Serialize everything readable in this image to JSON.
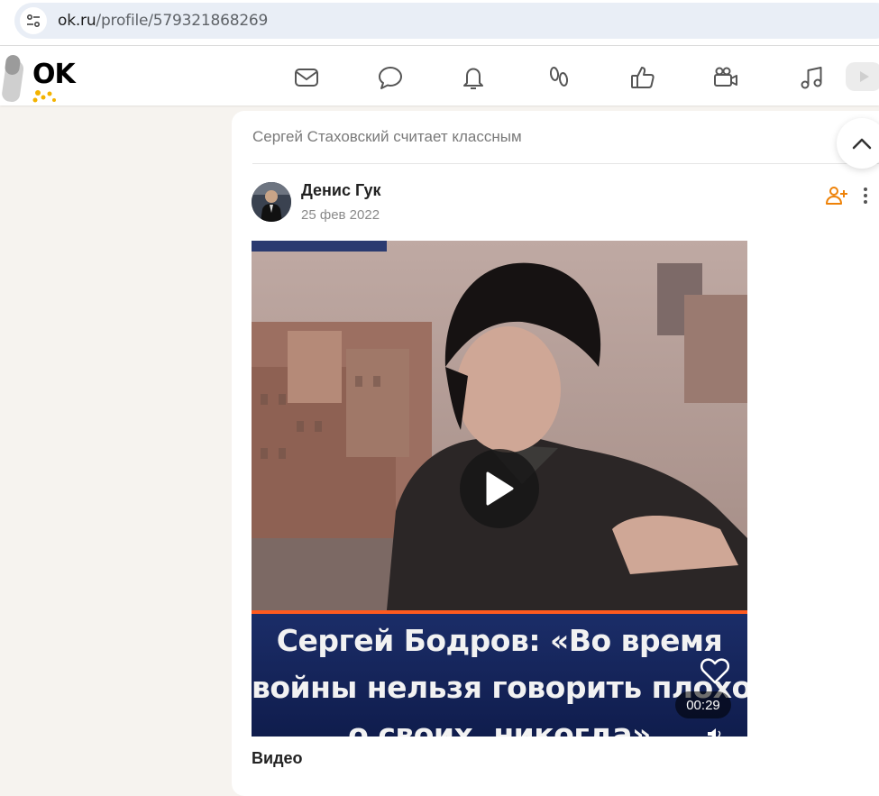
{
  "browser": {
    "url_host": "ok.ru",
    "url_path": "/profile/579321868269"
  },
  "toolbar": {
    "logo_text": "OK",
    "icons": [
      "mail-icon",
      "chat-icon",
      "bell-icon",
      "friends-icon",
      "like-icon",
      "video-camera-icon",
      "music-icon"
    ]
  },
  "feed": {
    "liked_by_text": "Сергей Стаховский считает классным",
    "post": {
      "author": "Денис Гук",
      "date": "25 фев 2022",
      "video": {
        "caption_lines": [
          "Сергей Бодров: «Во время",
          "войны нельзя говорить плохо",
          "о своих, никогда»"
        ],
        "duration": "00:29"
      },
      "content_label": "Видео"
    }
  },
  "colors": {
    "accent_orange": "#ee8208",
    "caption_bg": "#1b2d68",
    "page_bg": "#f6f3ef"
  }
}
